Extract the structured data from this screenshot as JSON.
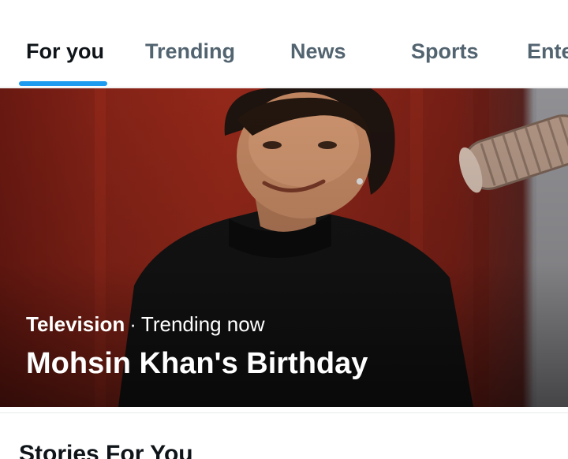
{
  "tabs": [
    {
      "label": "For you",
      "active": true
    },
    {
      "label": "Trending",
      "active": false
    },
    {
      "label": "News",
      "active": false
    },
    {
      "label": "Sports",
      "active": false
    },
    {
      "label": "Ente",
      "active": false
    }
  ],
  "hero": {
    "category": "Television",
    "separator": "·",
    "status": "Trending now",
    "title": "Mohsin Khan's Birthday",
    "image": "portrait-photo"
  },
  "section": {
    "title": "Stories For You"
  },
  "colors": {
    "accent": "#1d9bf0",
    "text_primary": "#0f1419",
    "text_secondary": "#536471"
  }
}
